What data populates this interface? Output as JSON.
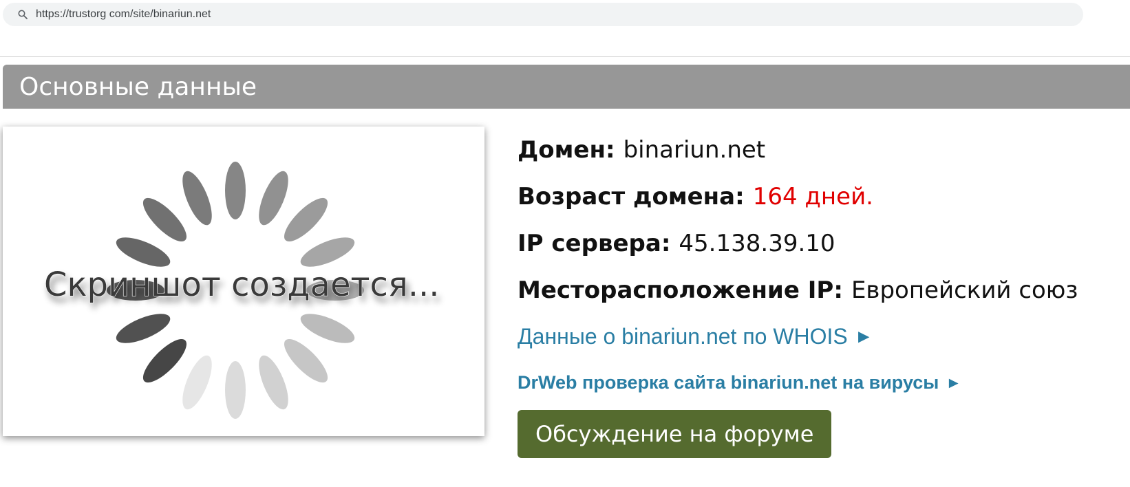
{
  "browser": {
    "url": "https://trustorg com/site/binariun.net"
  },
  "section": {
    "title": "Основные данные"
  },
  "screenshot": {
    "placeholder_text": "Скриншот создается..."
  },
  "info": {
    "domain_label": "Домен:",
    "domain_value": "binariun.net",
    "age_label": "Возраст домена:",
    "age_value": "164 дней.",
    "ip_label": "IP сервера:",
    "ip_value": "45.138.39.10",
    "location_label": "Месторасположение IP:",
    "location_value": "Европейский союз"
  },
  "links": {
    "whois": "Данные о binariun.net по WHOIS",
    "drweb": "DrWeb проверка сайта binariun.net на вирусы",
    "arrow": "►"
  },
  "forum_button": {
    "label": "Обсуждение на форуме"
  },
  "colors": {
    "header_bg": "#979797",
    "link": "#2a7ea4",
    "age_highlight": "#e00000",
    "button_bg": "#556b2f"
  }
}
